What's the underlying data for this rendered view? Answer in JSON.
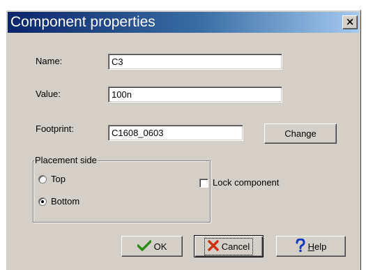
{
  "window": {
    "title": "Component properties",
    "close_glyph": "×"
  },
  "fields": {
    "name_label": "Name:",
    "name_value": "C3",
    "value_label": "Value:",
    "value_value": "100n",
    "footprint_label": "Footprint:",
    "footprint_value": "C1608_0603",
    "change_button": "Change"
  },
  "placement": {
    "legend": "Placement side",
    "options": [
      {
        "label": "Top",
        "selected": false
      },
      {
        "label": "Bottom",
        "selected": true
      }
    ]
  },
  "lock": {
    "label": "Lock component",
    "checked": false
  },
  "buttons": {
    "ok": "OK",
    "cancel": "Cancel",
    "help_mnemonic": "H",
    "help_rest": "elp"
  },
  "colors": {
    "titlebar_start": "#0a246a",
    "titlebar_end": "#a6caf0",
    "dialog_face": "#d4d0c8",
    "ok_check": "#2e8b16",
    "cancel_x": "#d03010",
    "help_question": "#1038c0"
  },
  "icons": {
    "ok": "check-icon",
    "cancel": "x-icon",
    "help": "question-mark-icon",
    "close": "close-icon"
  }
}
